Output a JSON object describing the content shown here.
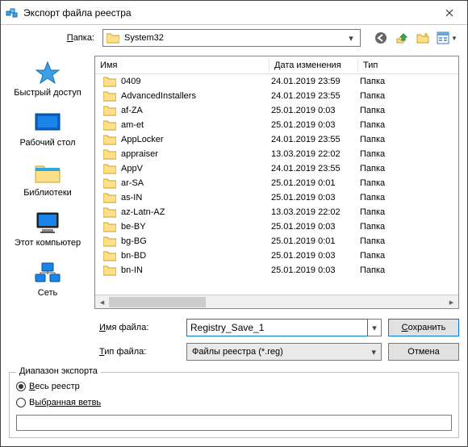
{
  "title": "Экспорт файла реестра",
  "path": {
    "label_prefix": "П",
    "label_rest": "апка:",
    "folder": "System32"
  },
  "toolbar_icons": [
    "back-icon",
    "up-icon",
    "new-folder-icon",
    "view-icon"
  ],
  "places": [
    {
      "label": "Быстрый доступ",
      "icon": "quick-access-icon"
    },
    {
      "label": "Рабочий стол",
      "icon": "desktop-icon"
    },
    {
      "label": "Библиотеки",
      "icon": "libraries-icon"
    },
    {
      "label": "Этот компьютер",
      "icon": "this-pc-icon"
    },
    {
      "label": "Сеть",
      "icon": "network-icon"
    }
  ],
  "columns": {
    "name": "Имя",
    "date": "Дата изменения",
    "type": "Тип"
  },
  "rows": [
    {
      "name": "0409",
      "date": "24.01.2019 23:59",
      "type": "Папка"
    },
    {
      "name": "AdvancedInstallers",
      "date": "24.01.2019 23:55",
      "type": "Папка"
    },
    {
      "name": "af-ZA",
      "date": "25.01.2019 0:03",
      "type": "Папка"
    },
    {
      "name": "am-et",
      "date": "25.01.2019 0:03",
      "type": "Папка"
    },
    {
      "name": "AppLocker",
      "date": "24.01.2019 23:55",
      "type": "Папка"
    },
    {
      "name": "appraiser",
      "date": "13.03.2019 22:02",
      "type": "Папка"
    },
    {
      "name": "AppV",
      "date": "24.01.2019 23:55",
      "type": "Папка"
    },
    {
      "name": "ar-SA",
      "date": "25.01.2019 0:01",
      "type": "Папка"
    },
    {
      "name": "as-IN",
      "date": "25.01.2019 0:03",
      "type": "Папка"
    },
    {
      "name": "az-Latn-AZ",
      "date": "13.03.2019 22:02",
      "type": "Папка"
    },
    {
      "name": "be-BY",
      "date": "25.01.2019 0:03",
      "type": "Папка"
    },
    {
      "name": "bg-BG",
      "date": "25.01.2019 0:01",
      "type": "Папка"
    },
    {
      "name": "bn-BD",
      "date": "25.01.2019 0:03",
      "type": "Папка"
    },
    {
      "name": "bn-IN",
      "date": "25.01.2019 0:03",
      "type": "Папка"
    }
  ],
  "filename": {
    "label_prefix": "И",
    "label_rest": "мя файла:",
    "value": "Registry_Save_1"
  },
  "filetype": {
    "label_prefix": "Т",
    "label_rest": "ип файла:",
    "value": "Файлы реестра (*.reg)"
  },
  "buttons": {
    "save_prefix": "С",
    "save_rest": "охранить",
    "cancel": "Отмена"
  },
  "export": {
    "group": "Диапазон экспорта",
    "all_prefix": "В",
    "all_rest": "есь реестр",
    "branch_prefix": "В",
    "branch_rest": "ыбранная ветвь",
    "selected": "all",
    "branch_value": ""
  }
}
